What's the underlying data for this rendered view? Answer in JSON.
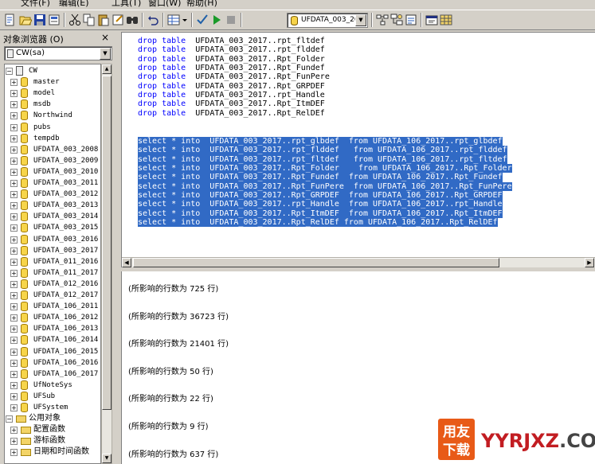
{
  "menu": {
    "items": [
      "文件(F)",
      "编辑(E)",
      "工具(T)",
      "窗口(W)",
      "帮助(H)"
    ]
  },
  "toolbar": {
    "database_selected": "UFDATA_003_20",
    "icons": [
      "new-query-icon",
      "open-icon",
      "save-icon",
      "insert-template-icon",
      "cut-icon",
      "copy-icon",
      "paste-icon",
      "clear-icon",
      "find-icon",
      "undo-icon",
      "results-mode-icon",
      "parse-icon",
      "execute-icon",
      "cancel-icon",
      "database-icon",
      "estimated-plan-icon",
      "object-search-icon",
      "options-icon",
      "properties-icon",
      "grid-icon"
    ]
  },
  "object_browser": {
    "title": "对象浏览器 (O)",
    "close": "×",
    "server_selected": "CW(sa)",
    "tree": [
      {
        "label": "CW",
        "type": "server"
      },
      {
        "label": "master",
        "type": "db"
      },
      {
        "label": "model",
        "type": "db"
      },
      {
        "label": "msdb",
        "type": "db"
      },
      {
        "label": "Northwind",
        "type": "db"
      },
      {
        "label": "pubs",
        "type": "db"
      },
      {
        "label": "tempdb",
        "type": "db"
      },
      {
        "label": "UFDATA_003_2008",
        "type": "db"
      },
      {
        "label": "UFDATA_003_2009",
        "type": "db"
      },
      {
        "label": "UFDATA_003_2010",
        "type": "db"
      },
      {
        "label": "UFDATA_003_2011",
        "type": "db"
      },
      {
        "label": "UFDATA_003_2012",
        "type": "db"
      },
      {
        "label": "UFDATA_003_2013",
        "type": "db"
      },
      {
        "label": "UFDATA_003_2014",
        "type": "db"
      },
      {
        "label": "UFDATA_003_2015",
        "type": "db"
      },
      {
        "label": "UFDATA_003_2016",
        "type": "db"
      },
      {
        "label": "UFDATA_003_2017",
        "type": "db"
      },
      {
        "label": "UFDATA_011_2016",
        "type": "db"
      },
      {
        "label": "UFDATA_011_2017",
        "type": "db"
      },
      {
        "label": "UFDATA_012_2016",
        "type": "db"
      },
      {
        "label": "UFDATA_012_2017",
        "type": "db"
      },
      {
        "label": "UFDATA_106_2011",
        "type": "db"
      },
      {
        "label": "UFDATA_106_2012",
        "type": "db"
      },
      {
        "label": "UFDATA_106_2013",
        "type": "db"
      },
      {
        "label": "UFDATA_106_2014",
        "type": "db"
      },
      {
        "label": "UFDATA_106_2015",
        "type": "db"
      },
      {
        "label": "UFDATA_106_2016",
        "type": "db"
      },
      {
        "label": "UFDATA_106_2017",
        "type": "db"
      },
      {
        "label": "UfNoteSys",
        "type": "db"
      },
      {
        "label": "UFSub",
        "type": "db"
      },
      {
        "label": "UFSystem",
        "type": "db"
      },
      {
        "label": "公用对象",
        "type": "group"
      },
      {
        "label": "配置函数",
        "type": "folder"
      },
      {
        "label": "游标函数",
        "type": "folder"
      },
      {
        "label": "日期和时间函数",
        "type": "folder"
      }
    ]
  },
  "editor": {
    "drop_lines": [
      {
        "kw": "drop table",
        "rest": "  UFDATA_003_2017..rpt_fltdef"
      },
      {
        "kw": "drop table",
        "rest": "  UFDATA_003_2017..rpt_flddef"
      },
      {
        "kw": "drop table",
        "rest": "  UFDATA_003_2017..Rpt_Folder"
      },
      {
        "kw": "drop table",
        "rest": "  UFDATA_003_2017..Rpt_Fundef"
      },
      {
        "kw": "drop table",
        "rest": "  UFDATA_003_2017..Rpt_FunPere"
      },
      {
        "kw": "drop table",
        "rest": "  UFDATA_003_2017..Rpt_GRPDEF"
      },
      {
        "kw": "drop table",
        "rest": "  UFDATA_003_2017..rpt_Handle"
      },
      {
        "kw": "drop table",
        "rest": "  UFDATA_003_2017..Rpt_ItmDEF"
      },
      {
        "kw": "drop table",
        "rest": "  UFDATA_003_2017..Rpt_RelDEf"
      }
    ],
    "select_lines": [
      "select * into  UFDATA_003_2017..rpt_glbdef  from UFDATA_106_2017..rpt_glbdef",
      "select * into  UFDATA_003_2017..rpt_flddef   from UFDATA_106_2017..rpt_flddef",
      "select * into  UFDATA_003_2017..rpt_fltdef   from UFDATA_106_2017..rpt_fltdef",
      "select * into  UFDATA_003_2017..Rpt_Folder    from UFDATA_106_2017..Rpt_Folder",
      "select * into  UFDATA_003_2017..Rpt_Fundef  from UFDATA_106_2017..Rpt_Fundef",
      "select * into  UFDATA_003_2017..Rpt_FunPere  from UFDATA_106_2017..Rpt_FunPere",
      "select * into  UFDATA_003_2017..Rpt_GRPDEF  from UFDATA_106_2017..Rpt_GRPDEF",
      "select * into  UFDATA_003_2017..rpt_Handle  from UFDATA_106_2017..rpt_Handle",
      "select * into  UFDATA_003_2017..Rpt_ItmDEF  from UFDATA_106_2017..Rpt_ItmDEF",
      "select * into  UFDATA_003_2017..Rpt_RelDEf from UFDATA_106_2017..Rpt_RelDEf"
    ]
  },
  "results": {
    "lines": [
      "(所影响的行数为 725 行)",
      "(所影响的行数为 36723 行)",
      "(所影响的行数为 21401 行)",
      "(所影响的行数为 50 行)",
      "(所影响的行数为 22 行)",
      "(所影响的行数为 9 行)",
      "(所影响的行数为 637 行)"
    ]
  },
  "watermark": {
    "badge_top": "用友",
    "badge_bottom": "下载",
    "site": "YYRJXZ",
    "domain": ".COM"
  },
  "colors": {
    "selection": "#316ac5",
    "keyword": "#0000ff",
    "chrome": "#d4d0c8",
    "watermark_red": "#c21d22"
  }
}
